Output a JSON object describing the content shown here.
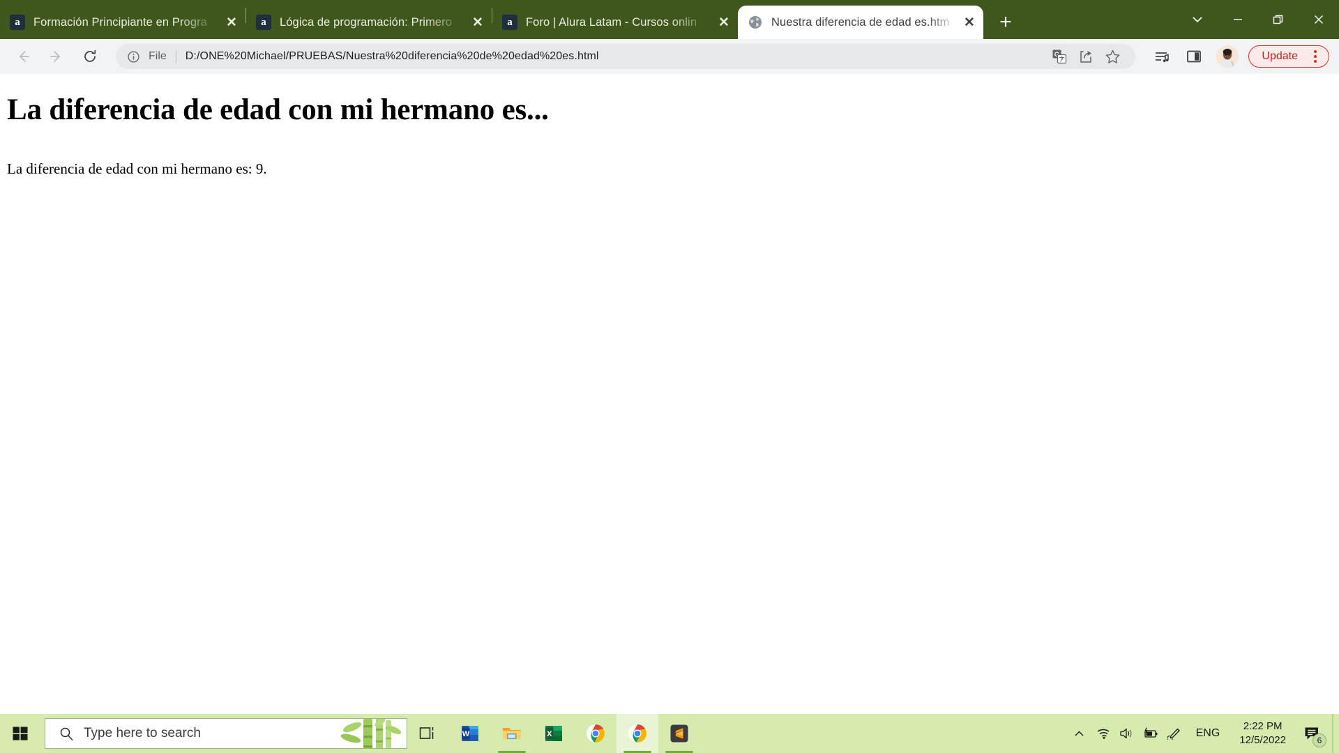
{
  "window": {
    "chrome_theme_color": "#3f571c",
    "controls": [
      {
        "name": "tab-search",
        "glyph": "chevron-down-icon"
      },
      {
        "name": "minimize",
        "glyph": "minimize-icon"
      },
      {
        "name": "maximize",
        "glyph": "maximize-icon"
      },
      {
        "name": "close",
        "glyph": "close-icon"
      }
    ]
  },
  "tabs": [
    {
      "title": "Formación Principiante en Progra",
      "favicon": "alura-favicon",
      "favicon_letter": "a",
      "active": false,
      "close_label": "✕"
    },
    {
      "title": "Lógica de programación: Primero",
      "favicon": "alura-favicon",
      "favicon_letter": "a",
      "active": false,
      "close_label": "✕"
    },
    {
      "title": "Foro | Alura Latam - Cursos onlin",
      "favicon": "alura-favicon",
      "favicon_letter": "a",
      "active": false,
      "close_label": "✕"
    },
    {
      "title": "Nuestra diferencia de edad es.htm",
      "favicon": "globe-icon",
      "favicon_letter": "",
      "active": true,
      "close_label": "✕"
    }
  ],
  "new_tab_label": "+",
  "toolbar": {
    "back_label": "Back",
    "forward_label": "Forward",
    "reload_label": "Reload",
    "site_info_label": "View site information",
    "scheme_label": "File",
    "url": "D:/ONE%20Michael/PRUEBAS/Nuestra%20diferencia%20de%20edad%20es.html",
    "omnibox_actions": [
      {
        "name": "translate-icon",
        "label": "Translate this page"
      },
      {
        "name": "share-icon",
        "label": "Share this page"
      },
      {
        "name": "bookmark-star-icon",
        "label": "Bookmark this tab"
      }
    ],
    "right_icons": [
      {
        "name": "reading-list-icon",
        "label": "Reading list"
      },
      {
        "name": "side-panel-icon",
        "label": "Show side panel"
      }
    ],
    "avatar_label": "Profile",
    "update_label": "Update",
    "update_accent": "#d93025",
    "menu_label": "Customize and control Google Chrome"
  },
  "page": {
    "heading": "La diferencia de edad con mi hermano es...",
    "paragraph": "La diferencia de edad con mi hermano es: 9."
  },
  "taskbar": {
    "background": "#d6ecaf",
    "start_label": "Start",
    "search": {
      "placeholder": "Type here to search",
      "value": ""
    },
    "apps": [
      {
        "name": "task-view-icon",
        "label": "Task View",
        "active": false,
        "running": false
      },
      {
        "name": "word-icon",
        "label": "Microsoft Word",
        "active": false,
        "running": false
      },
      {
        "name": "file-explorer-icon",
        "label": "File Explorer",
        "active": false,
        "running": true
      },
      {
        "name": "excel-icon",
        "label": "Microsoft Excel",
        "active": false,
        "running": false
      },
      {
        "name": "chrome-icon",
        "label": "Google Chrome",
        "active": false,
        "running": false
      },
      {
        "name": "chrome-icon",
        "label": "Google Chrome",
        "active": true,
        "running": true
      },
      {
        "name": "sublime-text-icon",
        "label": "Sublime Text",
        "active": false,
        "running": true
      }
    ],
    "tray": {
      "icons": [
        {
          "name": "show-hidden-icons-chevron",
          "label": "Show hidden icons"
        },
        {
          "name": "wifi-icon",
          "label": "Network"
        },
        {
          "name": "volume-icon",
          "label": "Speakers"
        },
        {
          "name": "battery-charging-icon",
          "label": "Battery charging"
        },
        {
          "name": "pen-icon",
          "label": "Windows Ink Workspace"
        }
      ],
      "language": "ENG",
      "time": "2:22 PM",
      "date": "12/5/2022",
      "notification_count": "6"
    }
  }
}
